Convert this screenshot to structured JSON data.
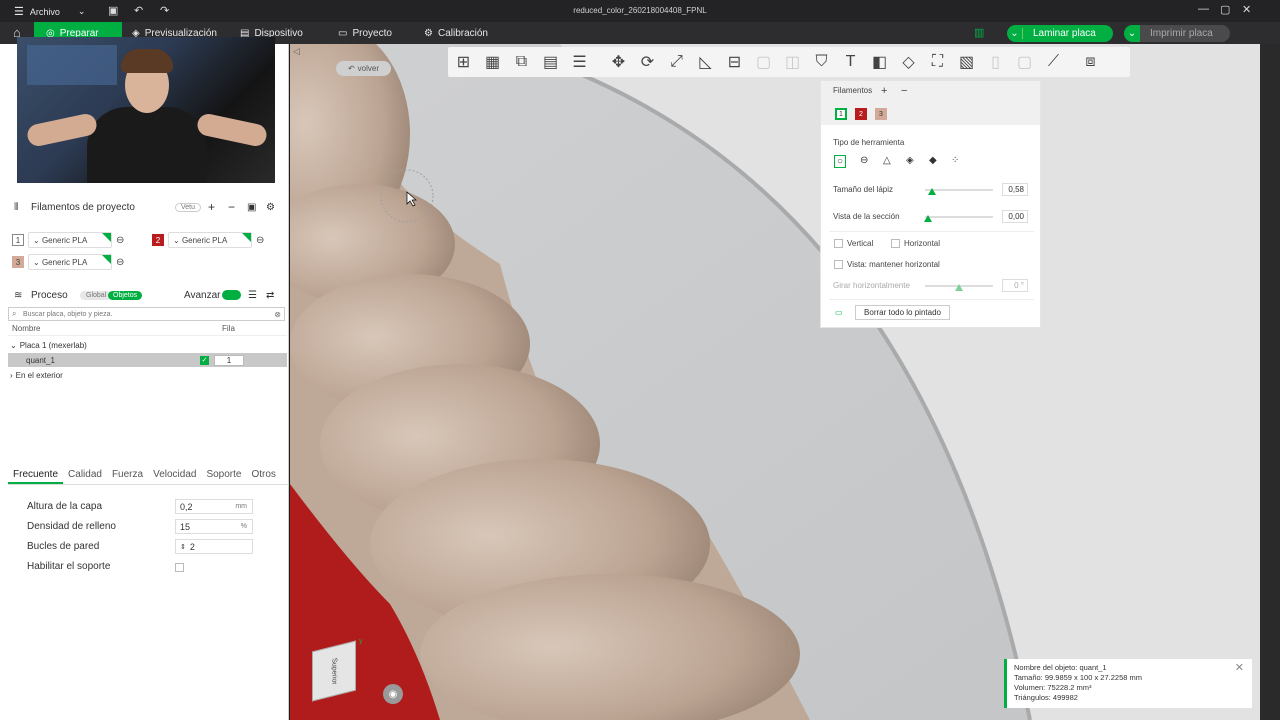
{
  "titlebar": {
    "menu_label": "Archivo",
    "title": "reduced_color_260218004408_FPNL"
  },
  "nav": {
    "tabs": [
      "Preparar",
      "Previsualización",
      "Dispositivo",
      "Proyecto",
      "Calibración"
    ],
    "slice_label": "Laminar placa",
    "print_label": "Imprimir placa"
  },
  "filaments_section": {
    "title": "Filamentos de proyecto",
    "badge": "Vetu",
    "items": [
      {
        "num": "1",
        "name": "Generic PLA",
        "color": "#ffffff"
      },
      {
        "num": "2",
        "name": "Generic PLA",
        "color": "#b81c1c"
      },
      {
        "num": "3",
        "name": "Generic PLA",
        "color": "#d3aa98"
      }
    ]
  },
  "process": {
    "title": "Proceso",
    "global_label": "Global",
    "objects_label": "Objetos",
    "advanced_label": "Avanzar",
    "search_placeholder": "Buscar placa, objeto y pieza.",
    "col_name": "Nombre",
    "col_fila": "Fila",
    "plate": "Placa 1 (mexerlab)",
    "object": "quant_1",
    "object_fila": "1",
    "outside": "En el exterior"
  },
  "settings_tabs": [
    "Frecuente",
    "Calidad",
    "Fuerza",
    "Velocidad",
    "Soporte",
    "Otros"
  ],
  "settings": [
    {
      "label": "Altura de la capa",
      "value": "0,2",
      "unit": "mm"
    },
    {
      "label": "Densidad de relleno",
      "value": "15",
      "unit": "%"
    },
    {
      "label": "Bucles de pared",
      "value": "2",
      "unit": ""
    },
    {
      "label": "Habilitar el soporte",
      "value": "",
      "unit": ""
    }
  ],
  "viewport": {
    "back_label": "volver",
    "cube_label": "Superior"
  },
  "paint_panel": {
    "filaments_title": "Filamentos",
    "swatches": [
      {
        "num": "1",
        "color": "#ffffff"
      },
      {
        "num": "2",
        "color": "#b81c1c"
      },
      {
        "num": "3",
        "color": "#d3aa98"
      }
    ],
    "tool_type_title": "Tipo de herramienta",
    "pen_size_label": "Tamaño del lápiz",
    "pen_size_value": "0,58",
    "section_view_label": "Vista de la sección",
    "section_view_value": "0,00",
    "vertical_label": "Vertical",
    "horizontal_label": "Horizontal",
    "keep_horizontal_label": "Vista: mantener horizontal",
    "rotate_label": "Girar horizontalmente",
    "rotate_value": "0 °",
    "clear_label": "Borrar todo lo pintado"
  },
  "object_info": {
    "name": "Nombre del objeto: quant_1",
    "size": "Tamaño: 99.9859 x 100 x 27.2258 mm",
    "volume": "Volumen: 75228.2 mm³",
    "triangles": "Triángulos: 499982"
  }
}
